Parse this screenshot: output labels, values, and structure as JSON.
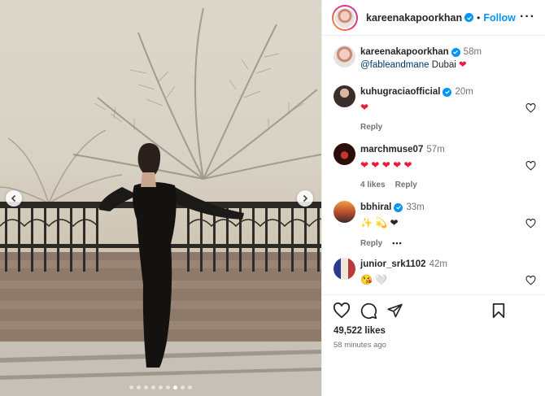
{
  "post": {
    "username": "kareenakapoorkhan",
    "follow_label": "Follow",
    "more_icon": "more-options-icon",
    "likes": "49,522 likes",
    "time_ago": "58 minutes ago"
  },
  "caption": {
    "username": "kareenakapoorkhan",
    "time": "58m",
    "mention": "@fableandmane",
    "text": " Dubai "
  },
  "comments": [
    {
      "username": "kuhugraciaofficial",
      "time": "20m",
      "verified": true,
      "text": "❤",
      "likes_label": "",
      "reply_label": "Reply"
    },
    {
      "username": "marchmuse07",
      "time": "57m",
      "verified": false,
      "text": "❤ ❤ ❤ ❤ ❤",
      "likes_label": "4 likes",
      "reply_label": "Reply"
    },
    {
      "username": "bbhiral",
      "time": "33m",
      "verified": true,
      "text": "✨ 💫 ❤",
      "likes_label": "",
      "reply_label": "Reply",
      "more": "•••"
    },
    {
      "username": "junior_srk1102",
      "time": "42m",
      "verified": false,
      "text": "😘 🤍"
    }
  ],
  "colors": {
    "accent": "#0095f6",
    "heart": "#ed1c3a",
    "text": "#262626",
    "muted": "#737373"
  },
  "carousel": {
    "dot_count": 9,
    "active_index": 6
  }
}
